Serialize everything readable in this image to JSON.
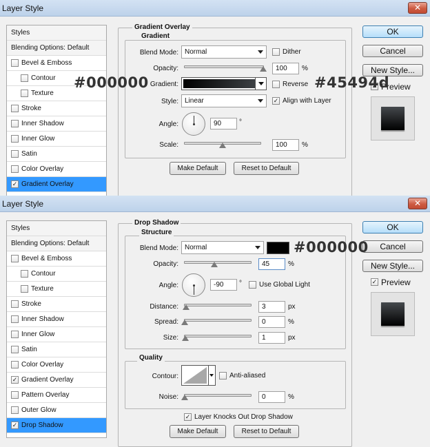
{
  "annotations": {
    "gradient_start": "#000000",
    "gradient_end": "#45494d",
    "shadow_color": "#000000"
  },
  "colors": {
    "gradient_start": "#000000",
    "gradient_end": "#45494d",
    "shadow": "#000000",
    "selection": "#3399ff"
  },
  "icons": {
    "close": "close-icon",
    "check": "checkmark-icon"
  },
  "dialog1": {
    "title": "Layer Style",
    "close_label": "✕",
    "styles": [
      {
        "label": "Styles",
        "type": "header"
      },
      {
        "label": "Blending Options: Default",
        "type": "header"
      },
      {
        "label": "Bevel & Emboss",
        "checked": false
      },
      {
        "label": "Contour",
        "checked": false,
        "indent": true
      },
      {
        "label": "Texture",
        "checked": false,
        "indent": true
      },
      {
        "label": "Stroke",
        "checked": false
      },
      {
        "label": "Inner Shadow",
        "checked": false
      },
      {
        "label": "Inner Glow",
        "checked": false
      },
      {
        "label": "Satin",
        "checked": false
      },
      {
        "label": "Color Overlay",
        "checked": false
      },
      {
        "label": "Gradient Overlay",
        "checked": true,
        "selected": true
      }
    ],
    "panel_title": "Gradient Overlay",
    "group_title": "Gradient",
    "blend_mode_label": "Blend Mode:",
    "blend_mode_value": "Normal",
    "dither_label": "Dither",
    "dither_checked": false,
    "opacity_label": "Opacity:",
    "opacity_value": "100",
    "opacity_fraction": 1.0,
    "percent": "%",
    "gradient_label": "Gradient:",
    "reverse_label": "Reverse",
    "reverse_checked": false,
    "style_label": "Style:",
    "style_value": "Linear",
    "align_label": "Align with Layer",
    "align_checked": true,
    "angle_label": "Angle:",
    "angle_value": "90",
    "degree": "°",
    "scale_label": "Scale:",
    "scale_value": "100",
    "scale_fraction": 0.5,
    "make_default": "Make Default",
    "reset_default": "Reset to Default",
    "ok": "OK",
    "cancel": "Cancel",
    "new_style": "New Style...",
    "preview_label": "Preview",
    "preview_checked": true
  },
  "dialog2": {
    "title": "Layer Style",
    "close_label": "✕",
    "styles": [
      {
        "label": "Styles",
        "type": "header"
      },
      {
        "label": "Blending Options: Default",
        "type": "header"
      },
      {
        "label": "Bevel & Emboss",
        "checked": false
      },
      {
        "label": "Contour",
        "checked": false,
        "indent": true
      },
      {
        "label": "Texture",
        "checked": false,
        "indent": true
      },
      {
        "label": "Stroke",
        "checked": false
      },
      {
        "label": "Inner Shadow",
        "checked": false
      },
      {
        "label": "Inner Glow",
        "checked": false
      },
      {
        "label": "Satin",
        "checked": false
      },
      {
        "label": "Color Overlay",
        "checked": false
      },
      {
        "label": "Gradient Overlay",
        "checked": true
      },
      {
        "label": "Pattern Overlay",
        "checked": false
      },
      {
        "label": "Outer Glow",
        "checked": false
      },
      {
        "label": "Drop Shadow",
        "checked": true,
        "selected": true
      }
    ],
    "panel_title": "Drop Shadow",
    "group_title": "Structure",
    "blend_mode_label": "Blend Mode:",
    "blend_mode_value": "Normal",
    "opacity_label": "Opacity:",
    "opacity_value": "45",
    "opacity_fraction": 0.45,
    "percent": "%",
    "angle_label": "Angle:",
    "angle_value": "-90",
    "degree": "°",
    "global_light_label": "Use Global Light",
    "global_light_checked": false,
    "distance_label": "Distance:",
    "distance_value": "3",
    "spread_label": "Spread:",
    "spread_value": "0",
    "size_label": "Size:",
    "size_value": "1",
    "px": "px",
    "quality_title": "Quality",
    "contour_label": "Contour:",
    "antialiased_label": "Anti-aliased",
    "antialiased_checked": false,
    "noise_label": "Noise:",
    "noise_value": "0",
    "knockout_label": "Layer Knocks Out Drop Shadow",
    "knockout_checked": true,
    "make_default": "Make Default",
    "reset_default": "Reset to Default",
    "ok": "OK",
    "cancel": "Cancel",
    "new_style": "New Style...",
    "preview_label": "Preview",
    "preview_checked": true
  }
}
